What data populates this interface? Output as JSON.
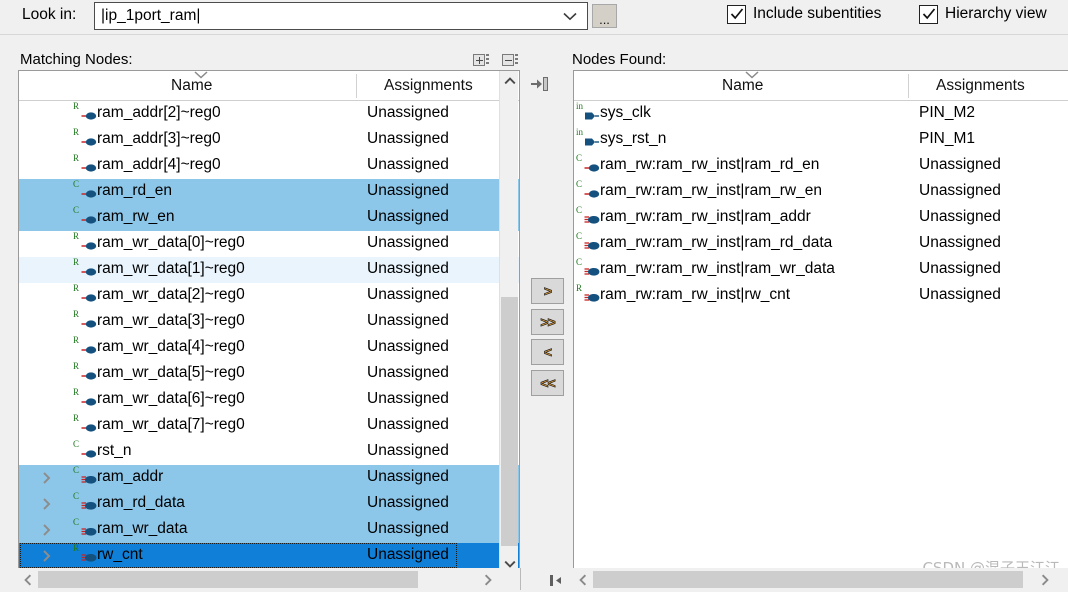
{
  "toolbar": {
    "look_in_label": "Look in:",
    "look_in_value": "|ip_1port_ram|",
    "browse_button_label": "...",
    "include_subentities_label": "Include subentities",
    "hierarchy_view_label": "Hierarchy view",
    "include_subentities_checked": true,
    "hierarchy_view_checked": true,
    "combo_arrow_icon": "chevron-down-icon",
    "expand_all_icon": "expand-all-icon",
    "collapse_all_icon": "collapse-all-icon"
  },
  "left_panel": {
    "title": "Matching Nodes:",
    "columns": [
      "Name",
      "Assignments"
    ],
    "sort_column": "Name",
    "sort_direction": "descending",
    "rows": [
      {
        "name": "ram_addr[2]~reg0",
        "assignment": "Unassigned",
        "icon": "register-node-icon",
        "icon_letter": "R",
        "state": "normal",
        "expandable": false
      },
      {
        "name": "ram_addr[3]~reg0",
        "assignment": "Unassigned",
        "icon": "register-node-icon",
        "icon_letter": "R",
        "state": "normal",
        "expandable": false
      },
      {
        "name": "ram_addr[4]~reg0",
        "assignment": "Unassigned",
        "icon": "register-node-icon",
        "icon_letter": "R",
        "state": "normal",
        "expandable": false
      },
      {
        "name": "ram_rd_en",
        "assignment": "Unassigned",
        "icon": "combinational-node-icon",
        "icon_letter": "C",
        "state": "selected",
        "expandable": false
      },
      {
        "name": "ram_rw_en",
        "assignment": "Unassigned",
        "icon": "combinational-node-icon",
        "icon_letter": "C",
        "state": "selected",
        "expandable": false
      },
      {
        "name": "ram_wr_data[0]~reg0",
        "assignment": "Unassigned",
        "icon": "register-node-icon",
        "icon_letter": "R",
        "state": "normal",
        "expandable": false
      },
      {
        "name": "ram_wr_data[1]~reg0",
        "assignment": "Unassigned",
        "icon": "register-node-icon",
        "icon_letter": "R",
        "state": "hover",
        "expandable": false
      },
      {
        "name": "ram_wr_data[2]~reg0",
        "assignment": "Unassigned",
        "icon": "register-node-icon",
        "icon_letter": "R",
        "state": "normal",
        "expandable": false
      },
      {
        "name": "ram_wr_data[3]~reg0",
        "assignment": "Unassigned",
        "icon": "register-node-icon",
        "icon_letter": "R",
        "state": "normal",
        "expandable": false
      },
      {
        "name": "ram_wr_data[4]~reg0",
        "assignment": "Unassigned",
        "icon": "register-node-icon",
        "icon_letter": "R",
        "state": "normal",
        "expandable": false
      },
      {
        "name": "ram_wr_data[5]~reg0",
        "assignment": "Unassigned",
        "icon": "register-node-icon",
        "icon_letter": "R",
        "state": "normal",
        "expandable": false
      },
      {
        "name": "ram_wr_data[6]~reg0",
        "assignment": "Unassigned",
        "icon": "register-node-icon",
        "icon_letter": "R",
        "state": "normal",
        "expandable": false
      },
      {
        "name": "ram_wr_data[7]~reg0",
        "assignment": "Unassigned",
        "icon": "register-node-icon",
        "icon_letter": "R",
        "state": "normal",
        "expandable": false
      },
      {
        "name": "rst_n",
        "assignment": "Unassigned",
        "icon": "combinational-node-icon",
        "icon_letter": "C",
        "state": "normal",
        "expandable": false
      },
      {
        "name": "ram_addr",
        "assignment": "Unassigned",
        "icon": "bus-node-icon",
        "icon_letter": "C",
        "state": "selected",
        "expandable": true
      },
      {
        "name": "ram_rd_data",
        "assignment": "Unassigned",
        "icon": "bus-node-icon",
        "icon_letter": "C",
        "state": "selected",
        "expandable": true
      },
      {
        "name": "ram_wr_data",
        "assignment": "Unassigned",
        "icon": "bus-node-icon",
        "icon_letter": "C",
        "state": "selected",
        "expandable": true
      },
      {
        "name": "rw_cnt",
        "assignment": "Unassigned",
        "icon": "bus-node-icon",
        "icon_letter": "R",
        "state": "selected-focused",
        "expandable": true
      }
    ]
  },
  "right_panel": {
    "title": "Nodes Found:",
    "columns": [
      "Name",
      "Assignments"
    ],
    "sort_column": "Name",
    "sort_direction": "descending",
    "rows": [
      {
        "name": "sys_clk",
        "assignment": "PIN_M2",
        "icon": "input-pin-icon",
        "icon_letter": "in"
      },
      {
        "name": "sys_rst_n",
        "assignment": "PIN_M1",
        "icon": "input-pin-icon",
        "icon_letter": "in"
      },
      {
        "name": "ram_rw:ram_rw_inst|ram_rd_en",
        "assignment": "Unassigned",
        "icon": "combinational-node-icon",
        "icon_letter": "C"
      },
      {
        "name": "ram_rw:ram_rw_inst|ram_rw_en",
        "assignment": "Unassigned",
        "icon": "combinational-node-icon",
        "icon_letter": "C"
      },
      {
        "name": "ram_rw:ram_rw_inst|ram_addr",
        "assignment": "Unassigned",
        "icon": "bus-node-icon",
        "icon_letter": "C"
      },
      {
        "name": "ram_rw:ram_rw_inst|ram_rd_data",
        "assignment": "Unassigned",
        "icon": "bus-node-icon",
        "icon_letter": "C"
      },
      {
        "name": "ram_rw:ram_rw_inst|ram_wr_data",
        "assignment": "Unassigned",
        "icon": "bus-node-icon",
        "icon_letter": "C"
      },
      {
        "name": "ram_rw:ram_rw_inst|rw_cnt",
        "assignment": "Unassigned",
        "icon": "bus-node-icon",
        "icon_letter": "R"
      }
    ]
  },
  "transfer_buttons": [
    {
      "label": ">",
      "name": "add-selected-button"
    },
    {
      "label": ">>",
      "name": "add-all-button"
    },
    {
      "label": "<",
      "name": "remove-selected-button"
    },
    {
      "label": "<<",
      "name": "remove-all-button"
    }
  ],
  "watermark": "CSDN @混子王江江",
  "colors": {
    "selection": "#8cc7ea",
    "selection_focused": "#0f7fd8",
    "hover": "#e9f4fc",
    "window_bg": "#f0f0f0",
    "list_bg": "#ffffff",
    "icon_green": "#1f7a1f",
    "icon_blue": "#14517f",
    "icon_red": "#cc2222",
    "button_arrow": "#e8a33d"
  }
}
